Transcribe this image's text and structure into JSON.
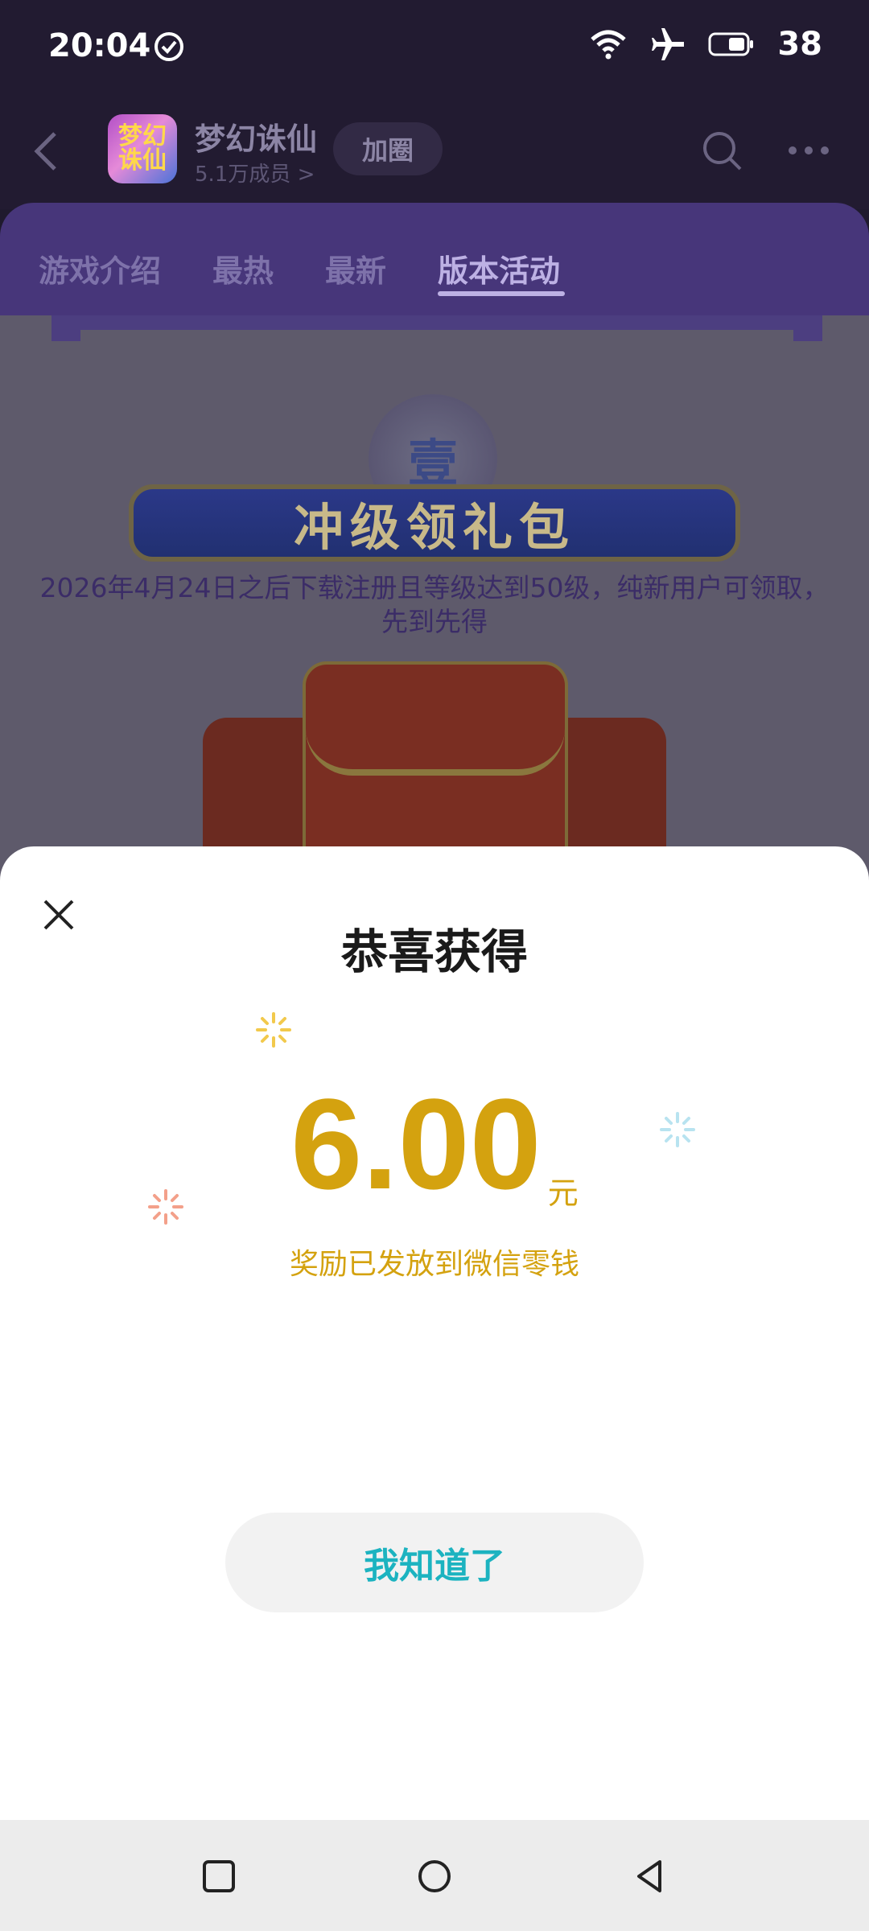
{
  "status_bar": {
    "time": "20:04",
    "battery": "38"
  },
  "group": {
    "name": "梦幻诛仙",
    "members": "5.1万成员 >",
    "join_label": "加圈",
    "avatar_text": "梦幻诛仙"
  },
  "tabs": [
    {
      "label": "游戏介绍",
      "active": false
    },
    {
      "label": "最热",
      "active": false
    },
    {
      "label": "最新",
      "active": false
    },
    {
      "label": "版本活动",
      "active": true
    }
  ],
  "activity": {
    "emblem": "壹",
    "banner": "冲级领礼包",
    "description": "2026年4月24日之后下载注册且等级达到50级，纯新用户可领取，先到先得"
  },
  "modal": {
    "title": "恭喜获得",
    "amount": "6.00",
    "currency": "元",
    "message": "奖励已发放到微信零钱",
    "confirm_label": "我知道了"
  },
  "icons": {
    "back": "back-arrow-icon",
    "search": "search-icon",
    "more": "more-icon",
    "close": "close-icon",
    "wifi": "wifi-icon",
    "airplane": "airplane-icon",
    "battery": "battery-icon",
    "check": "check-circle-icon"
  },
  "colors": {
    "accent_gold": "#d4a20f",
    "button_text": "#1cb3c0",
    "tab_bar": "#47367a"
  }
}
